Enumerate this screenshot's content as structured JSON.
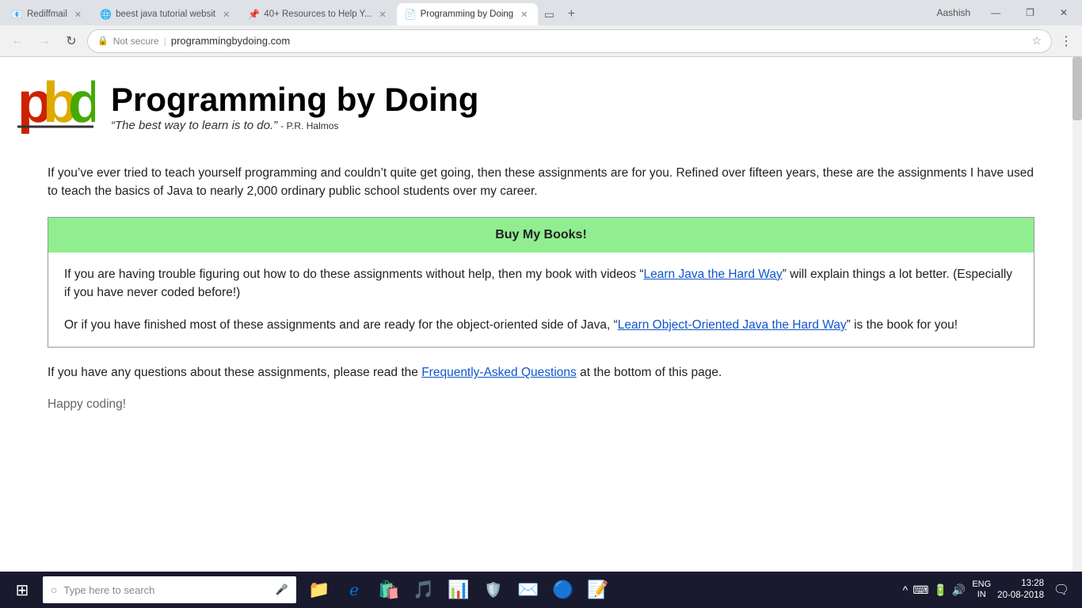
{
  "browser": {
    "tabs": [
      {
        "id": "tab1",
        "label": "Rediffmail",
        "favicon": "📧",
        "active": false,
        "url": ""
      },
      {
        "id": "tab2",
        "label": "beest java tutorial websit",
        "favicon": "🌐",
        "active": false,
        "url": ""
      },
      {
        "id": "tab3",
        "label": "40+ Resources to Help Y...",
        "favicon": "📌",
        "active": false,
        "url": ""
      },
      {
        "id": "tab4",
        "label": "Programming by Doing",
        "favicon": "📄",
        "active": true,
        "url": ""
      }
    ],
    "address": "programmingbydoing.com",
    "security": "Not secure",
    "user": "Aashish"
  },
  "site": {
    "logo_letters": "pbd",
    "title": "Programming by Doing",
    "quote": "“The best way to learn is to do.”",
    "quote_attr": "- P.R. Halmos",
    "intro_text": "If you’ve ever tried to teach yourself programming and couldn’t quite get going, then these assignments are for you. Refined over fifteen years, these are the assignments I have used to teach the basics of Java to nearly 2,000 ordinary public school students over my career.",
    "buy_box": {
      "header": "Buy My Books!",
      "para1_before": "If you are having trouble figuring out how to do these assignments without help, then my book with videos “",
      "para1_link": "Learn Java the Hard Way",
      "para1_after": "” will explain things a lot better. (Especially if you have never coded before!)",
      "para2_before": "Or if you have finished most of these assignments and are ready for the object-oriented side of Java, “",
      "para2_link": "Learn Object-Oriented Java the Hard Way",
      "para2_after": "” is the book for you!"
    },
    "faq_before": "If you have any questions about these assignments, please read the ",
    "faq_link": "Frequently-Asked Questions",
    "faq_after": " at the bottom of this page.",
    "happy_coding": "Happy coding!"
  },
  "taskbar": {
    "search_placeholder": "Type here to search",
    "apps": [
      {
        "name": "file-explorer",
        "icon": "📁"
      },
      {
        "name": "edge-browser",
        "icon": "🌐"
      },
      {
        "name": "store",
        "icon": "🛍️"
      },
      {
        "name": "media-player",
        "icon": "🎵"
      },
      {
        "name": "office",
        "icon": "📊"
      },
      {
        "name": "antivirus",
        "icon": "🛡️"
      },
      {
        "name": "mail",
        "icon": "✉️"
      },
      {
        "name": "chrome",
        "icon": "🔵"
      },
      {
        "name": "word",
        "icon": "📝"
      }
    ],
    "tray": {
      "lang": "ENG\nIN",
      "time": "13:28",
      "date": "20-08-2018"
    }
  }
}
